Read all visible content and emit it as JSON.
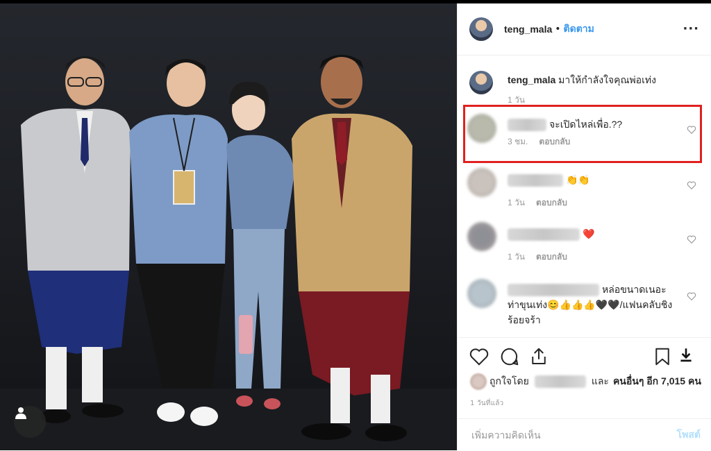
{
  "header": {
    "username": "teng_mala",
    "separator": "•",
    "follow_label": "ติดตาม",
    "more_label": "···"
  },
  "caption": {
    "username": "teng_mala",
    "text": "มาให้กำลังใจคุณพ่อเท่ง",
    "time": "1 วัน"
  },
  "comments": [
    {
      "text": "จะเปิดไหล่เพื่อ.??",
      "time": "3 ชม.",
      "reply": "ตอบกลับ",
      "highlighted": true
    },
    {
      "text": "👏👏",
      "time": "1 วัน",
      "reply": "ตอบกลับ"
    },
    {
      "text": "❤️",
      "time": "1 วัน",
      "reply": "ตอบกลับ"
    },
    {
      "text": "หล่อขนาดเนอะท่าขุนเท่ง😊👍👍👍🖤🖤/แฟนคลับชิงร้อยจร้า"
    }
  ],
  "likes": {
    "prefix": "ถูกใจโดย",
    "middle": "และ",
    "others": "คนอื่นๆ อีก 7,015 คน"
  },
  "timestamp": "1 วันที่แล้ว",
  "add_comment": {
    "placeholder": "เพิ่มความคิดเห็น",
    "post_label": "โพสต์"
  },
  "colors": {
    "accent": "#3897f0",
    "highlight": "#e0201f",
    "post_disabled": "#b2dffc"
  },
  "icons": [
    "heart-icon",
    "comment-icon",
    "share-icon",
    "bookmark-icon",
    "download-icon",
    "more-options-icon",
    "user-tag-icon"
  ]
}
